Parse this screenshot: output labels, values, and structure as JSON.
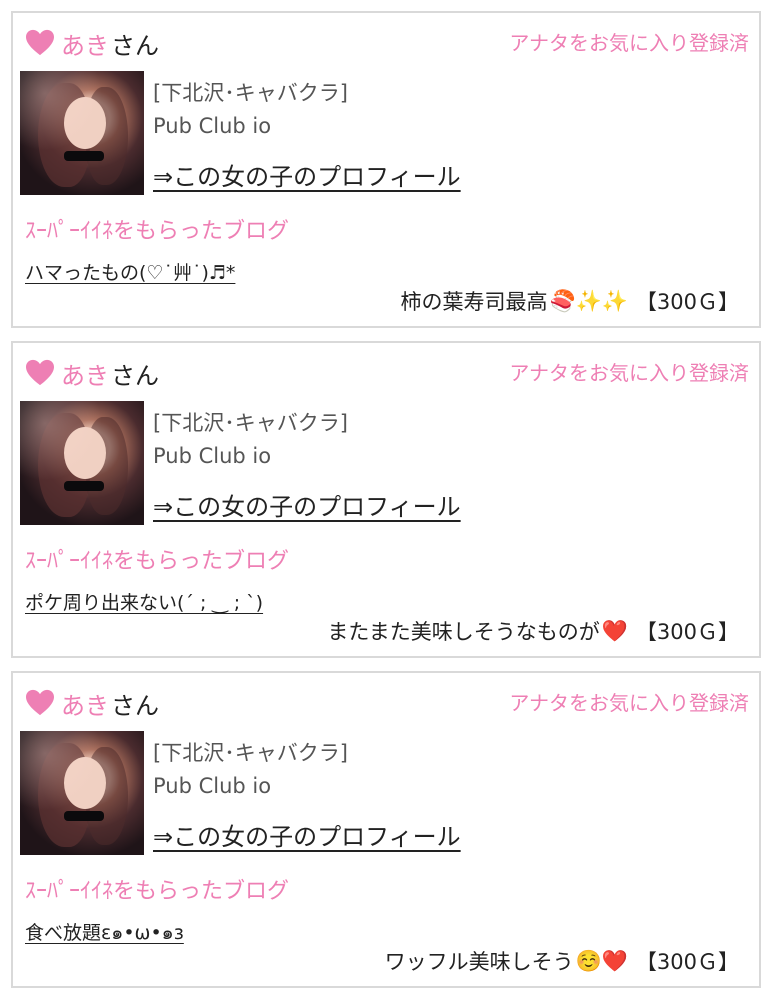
{
  "colors": {
    "accent": "#ee7fb4",
    "border": "#d9d9d9",
    "text": "#222222",
    "muted": "#555555"
  },
  "cards": [
    {
      "name": "あき",
      "suffix": "さん",
      "fav_status": "アナタをお気に入り登録済",
      "shop": "[下北沢･キャバクラ]",
      "club": "Pub Club io",
      "profile_link": "⇒この女の子のプロフィール",
      "section_label": "ｽｰﾊﾟｰｲｲﾈをもらったブログ",
      "blog_title": "ハマったもの(♡˙艸˙)♬*",
      "comment": "柿の葉寿司最高",
      "emoji": "🍣✨✨",
      "reward": "【300Ｇ】"
    },
    {
      "name": "あき",
      "suffix": "さん",
      "fav_status": "アナタをお気に入り登録済",
      "shop": "[下北沢･キャバクラ]",
      "club": "Pub Club io",
      "profile_link": "⇒この女の子のプロフィール",
      "section_label": "ｽｰﾊﾟｰｲｲﾈをもらったブログ",
      "blog_title": "ポケ周り出来ない(´ ; ‿ ; `)",
      "comment": "またまた美味しそうなものが",
      "emoji": "❤️",
      "reward": "【300Ｇ】"
    },
    {
      "name": "あき",
      "suffix": "さん",
      "fav_status": "アナタをお気に入り登録済",
      "shop": "[下北沢･キャバクラ]",
      "club": "Pub Club io",
      "profile_link": "⇒この女の子のプロフィール",
      "section_label": "ｽｰﾊﾟｰｲｲﾈをもらったブログ",
      "blog_title": "食べ放題ɛ๑•ω•๑ɜ",
      "comment": "ワッフル美味しそう",
      "emoji": "☺️❤️",
      "reward": "【300Ｇ】"
    }
  ]
}
